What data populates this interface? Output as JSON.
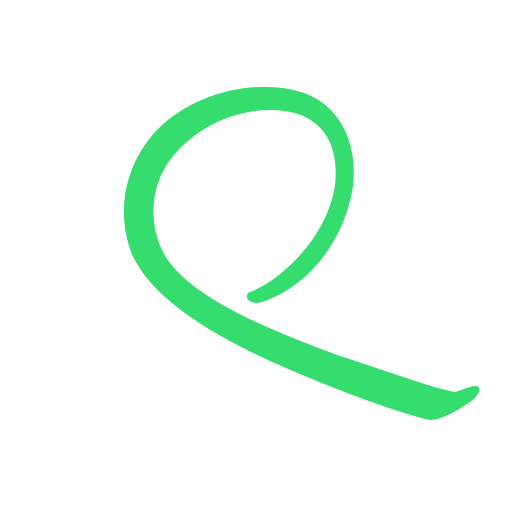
{
  "logo": {
    "icon": "looped-brush-stroke-icon",
    "stroke_color": "#34DD6D",
    "background_color": "#FFFFFF"
  }
}
